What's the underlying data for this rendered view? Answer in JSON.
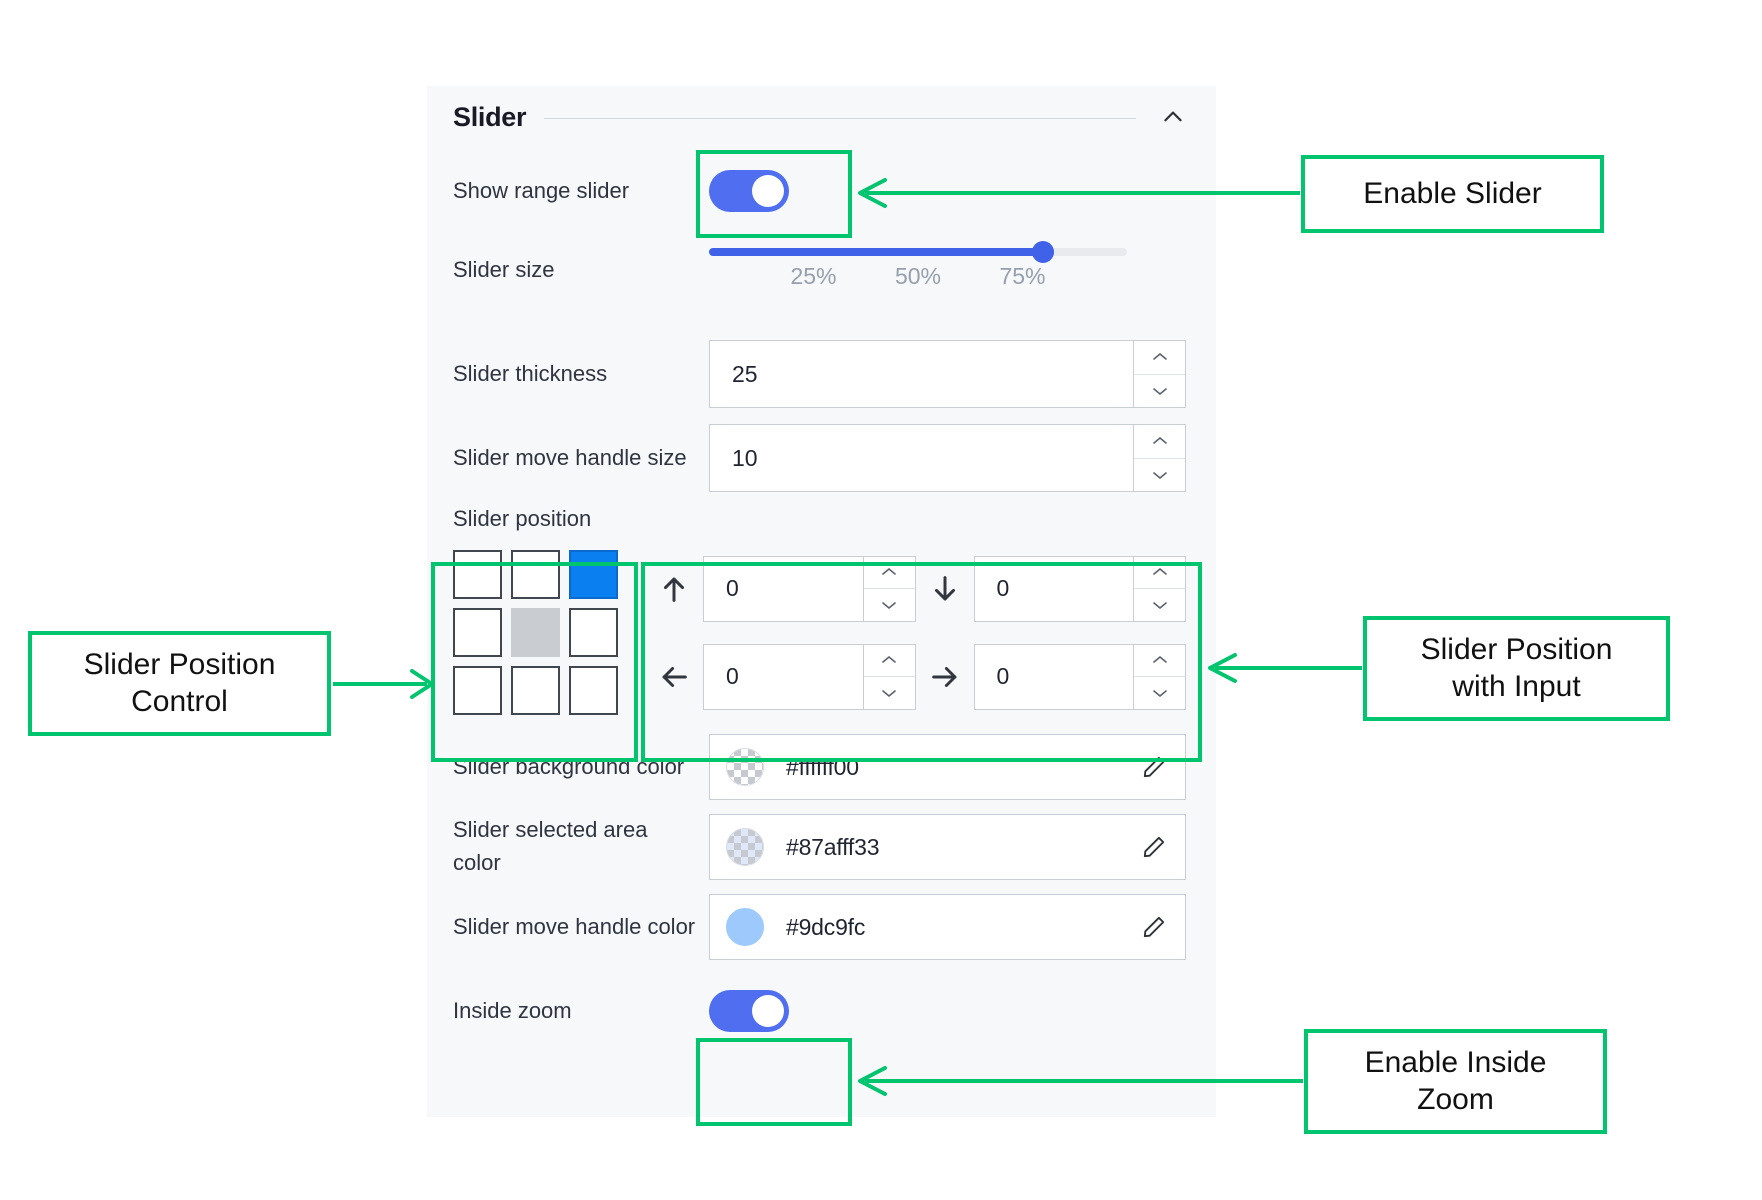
{
  "panel": {
    "title": "Slider",
    "collapse_icon": "chevron-up-icon",
    "rows": {
      "show_range_slider": {
        "label": "Show range slider",
        "toggle_state": "on"
      },
      "slider_size": {
        "label": "Slider size",
        "value_percent": 80,
        "ticks": [
          "25%",
          "50%",
          "75%"
        ],
        "tick_positions": [
          25,
          50,
          75
        ],
        "fill_color": "#3f62e8",
        "track_color": "#e8eaed"
      },
      "slider_thickness": {
        "label": "Slider thickness",
        "value": "25"
      },
      "slider_move_handle_size": {
        "label": "Slider move handle size",
        "value": "10"
      },
      "slider_position": {
        "label": "Slider position",
        "grid": [
          [
            "empty",
            "empty",
            "selected"
          ],
          [
            "empty",
            "center",
            "empty"
          ],
          [
            "empty",
            "empty",
            "empty"
          ]
        ],
        "selected_color": "#0a7ff0",
        "center_color": "#c9cdd1",
        "offsets": [
          {
            "icon": "arrow-up-icon",
            "value": "0"
          },
          {
            "icon": "arrow-down-icon",
            "value": "0"
          },
          {
            "icon": "arrow-left-icon",
            "value": "0"
          },
          {
            "icon": "arrow-right-icon",
            "value": "0"
          }
        ]
      },
      "slider_background_color": {
        "label": "Slider background color",
        "value": "#ffffff00",
        "swatch": "transparent-checker"
      },
      "slider_selected_area_color": {
        "label": "Slider selected area color",
        "value": "#87afff33",
        "swatch": "tinted-checker"
      },
      "slider_move_handle_color": {
        "label": "Slider move handle color",
        "value": "#9dc9fc",
        "swatch": "solid"
      },
      "inside_zoom": {
        "label": "Inside zoom",
        "toggle_state": "on"
      }
    }
  },
  "annotations": {
    "accent_color": "#00c46e",
    "callouts": [
      {
        "id": "enable-slider",
        "text": "Enable Slider"
      },
      {
        "id": "slider-position-control",
        "text": "Slider Position\nControl"
      },
      {
        "id": "slider-position-with-input",
        "text": "Slider Position\nwith Input"
      },
      {
        "id": "enable-inside-zoom",
        "text": "Enable Inside\nZoom"
      }
    ]
  }
}
